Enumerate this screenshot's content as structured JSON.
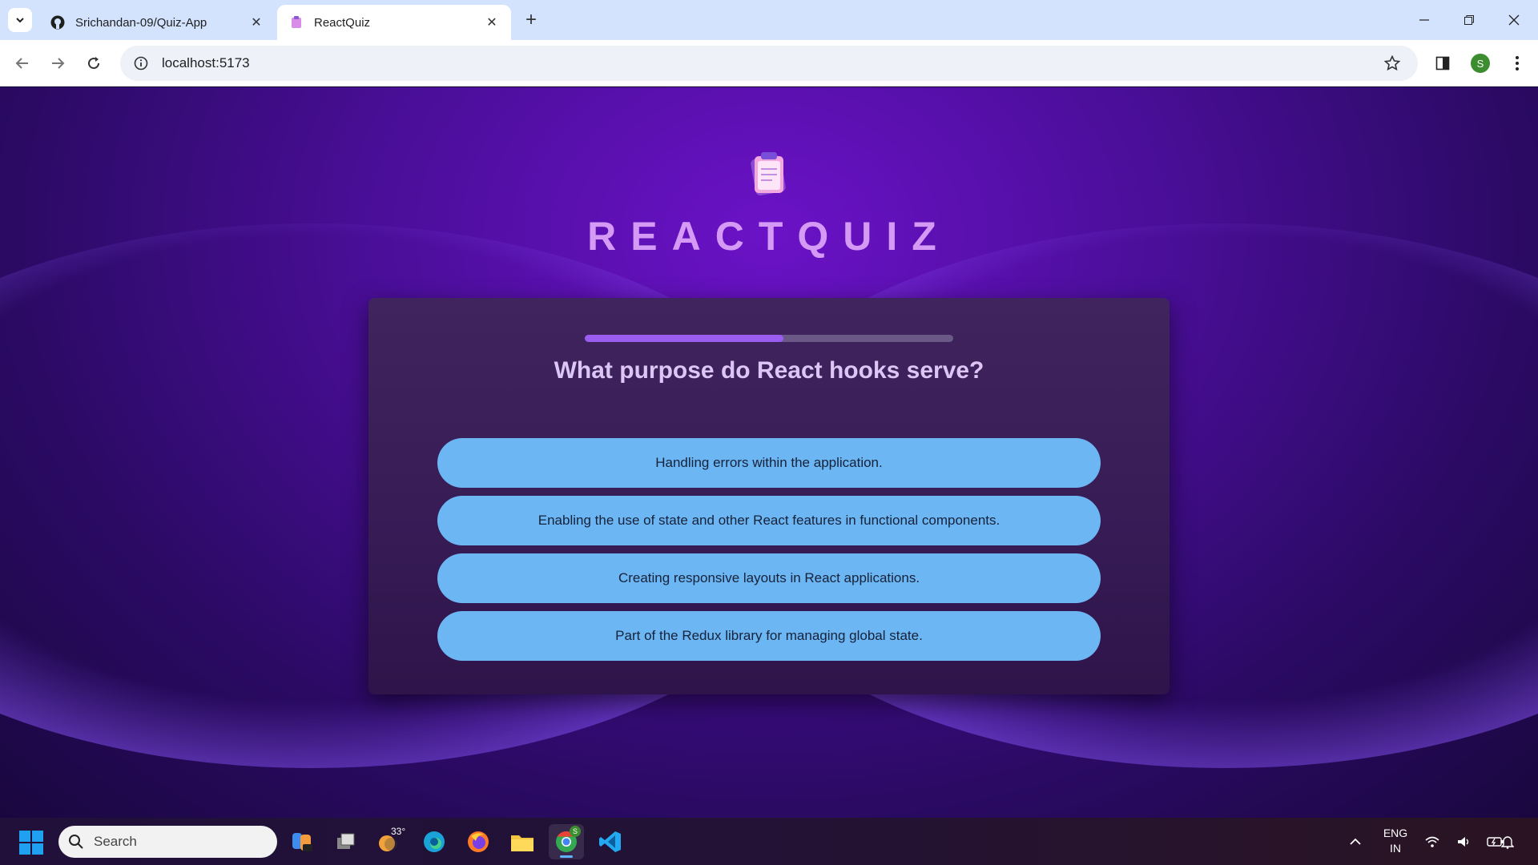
{
  "browser": {
    "tabs": [
      {
        "title": "Srichandan-09/Quiz-App",
        "favicon": "github-icon",
        "active": false
      },
      {
        "title": "ReactQuiz",
        "favicon": "react-quiz-icon",
        "active": true
      }
    ],
    "url": "localhost:5173",
    "profile_initial": "S"
  },
  "app": {
    "title": "REACTQUIZ",
    "logo": "clipboard-icon"
  },
  "quiz": {
    "progress": 0.54,
    "question": "What purpose do React hooks serve?",
    "answers": [
      "Handling errors within the application.",
      "Enabling the use of state and other React features in functional components.",
      "Creating responsive layouts in React applications.",
      "Part of the Redux library for managing global state."
    ]
  },
  "taskbar": {
    "search_placeholder": "Search",
    "weather_temp": "33°",
    "language": "ENG",
    "region": "IN",
    "chrome_badge": "S"
  },
  "colors": {
    "accent": "#9b5cf0",
    "answer_bg": "#6cb6f3",
    "title": "#d49af5"
  }
}
